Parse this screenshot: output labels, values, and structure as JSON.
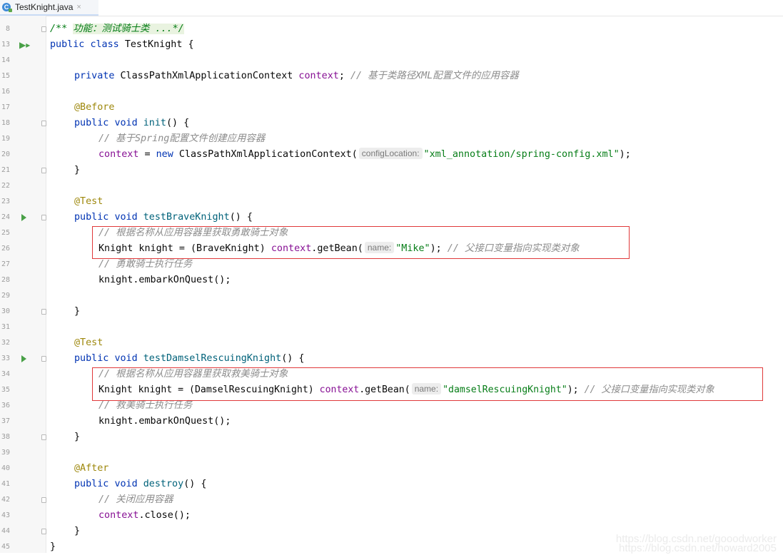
{
  "tab": {
    "filename": "TestKnight.java",
    "icon": "java-class-icon",
    "close": "×"
  },
  "gutter": {
    "line_numbers": [
      "8",
      "13",
      "14",
      "15",
      "16",
      "17",
      "18",
      "19",
      "20",
      "21",
      "22",
      "23",
      "24",
      "25",
      "26",
      "27",
      "28",
      "29",
      "30",
      "31",
      "32",
      "33",
      "34",
      "35",
      "36",
      "37",
      "38",
      "39",
      "40",
      "41",
      "42",
      "43",
      "44",
      "45"
    ]
  },
  "code": {
    "l8": {
      "fold": "/** ",
      "doc": "功能：测试骑士类 ...*/"
    },
    "l13": {
      "kw1": "public",
      "kw2": "class",
      "cls": "TestKnight {"
    },
    "l15": {
      "kw": "private",
      "type": "ClassPathXmlApplicationContext",
      "field": "context",
      "semi": ";",
      "comment": "// 基于类路径XML配置文件的应用容器"
    },
    "l17": {
      "ann": "@Before"
    },
    "l18": {
      "kw1": "public",
      "kw2": "void",
      "method": "init",
      "rest": "() {"
    },
    "l19": {
      "comment": "// 基于Spring配置文件创建应用容器"
    },
    "l20": {
      "field": "context",
      "eq": " = ",
      "kw": "new",
      "cls": " ClassPathXmlApplicationContext(",
      "hint": "configLocation:",
      "str": "\"xml_annotation/spring-config.xml\"",
      "end": ");"
    },
    "l21": {
      "text": "}"
    },
    "l23": {
      "ann": "@Test"
    },
    "l24": {
      "kw1": "public",
      "kw2": "void",
      "method": "testBraveKnight",
      "rest": "() {"
    },
    "l25": {
      "comment": "// 根据名称从应用容器里获取勇敢骑士对象"
    },
    "l26": {
      "pre": "Knight knight = (BraveKnight) ",
      "field": "context",
      "call": ".getBean(",
      "hint": "name:",
      "str": "\"Mike\"",
      "end": ");",
      "comment": "// 父接口变量指向实现类对象"
    },
    "l27": {
      "comment": "// 勇敢骑士执行任务"
    },
    "l28": {
      "text": "knight.embarkOnQuest();"
    },
    "l30": {
      "text": "}"
    },
    "l32": {
      "ann": "@Test"
    },
    "l33": {
      "kw1": "public",
      "kw2": "void",
      "method": "testDamselRescuingKnight",
      "rest": "() {"
    },
    "l34": {
      "comment": "// 根据名称从应用容器里获取救美骑士对象"
    },
    "l35": {
      "pre": "Knight knight = (DamselRescuingKnight) ",
      "field": "context",
      "call": ".getBean(",
      "hint": "name:",
      "str": "\"damselRescuingKnight\"",
      "end": ");",
      "comment": "// 父接口变量指向实现类对象"
    },
    "l36": {
      "comment": "// 救美骑士执行任务"
    },
    "l37": {
      "text": "knight.embarkOnQuest();"
    },
    "l38": {
      "text": "}"
    },
    "l40": {
      "ann": "@After"
    },
    "l41": {
      "kw1": "public",
      "kw2": "void",
      "method": "destroy",
      "rest": "() {"
    },
    "l42": {
      "comment": "// 关闭应用容器"
    },
    "l43": {
      "field": "context",
      "rest": ".close();"
    },
    "l44": {
      "text": "}"
    },
    "l45": {
      "text": "}"
    }
  },
  "watermark": {
    "line1": "https://blog.csdn.net/gooodworker",
    "line2": "https://blog.csdn.net/howard2005"
  },
  "colors": {
    "keyword": "#0033b3",
    "annotation": "#9e880d",
    "field": "#871094",
    "string": "#067d17",
    "method": "#00627a",
    "comment": "#8c8c8c",
    "highlight_box": "#e0393a"
  }
}
